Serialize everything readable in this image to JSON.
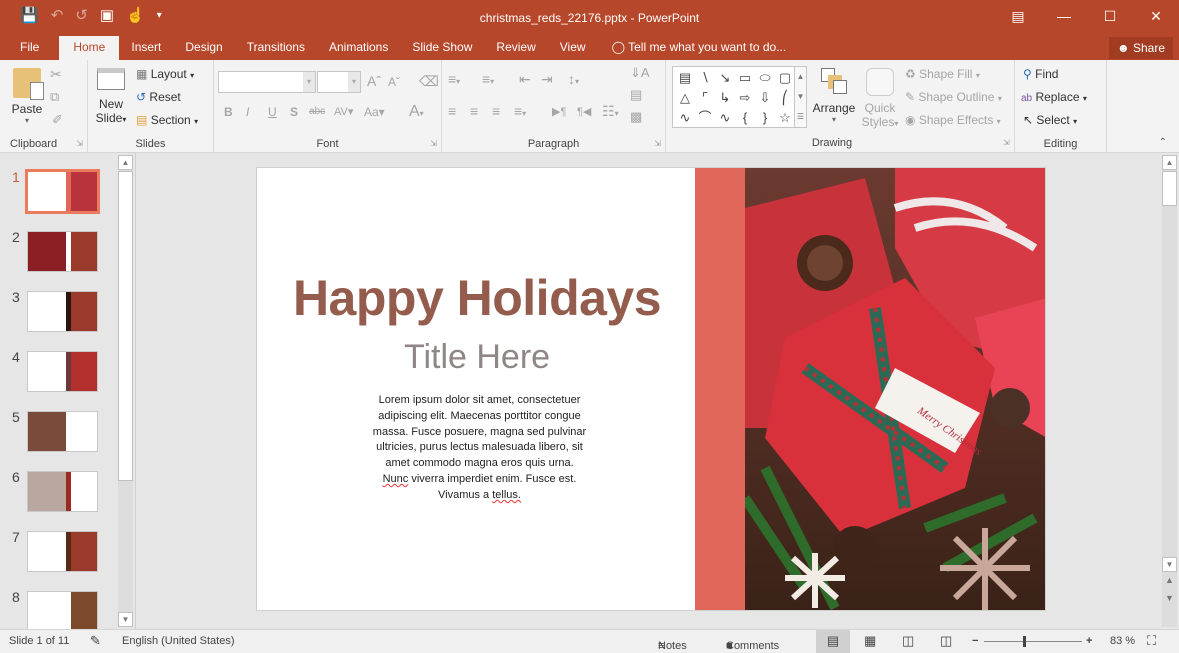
{
  "window": {
    "title": "christmas_reds_22176.pptx - PowerPoint",
    "controls": [
      "ribbon-display",
      "minimize",
      "maximize",
      "close"
    ]
  },
  "qat": {
    "icons": [
      "save-icon",
      "undo-icon",
      "redo-icon",
      "start-from-beginning-icon",
      "touch-mode-icon",
      "customize-qat-icon"
    ]
  },
  "tabs": [
    {
      "label": "File"
    },
    {
      "label": "Home",
      "active": true
    },
    {
      "label": "Insert"
    },
    {
      "label": "Design"
    },
    {
      "label": "Transitions"
    },
    {
      "label": "Animations"
    },
    {
      "label": "Slide Show"
    },
    {
      "label": "Review"
    },
    {
      "label": "View"
    }
  ],
  "tellme": "Tell me what you want to do...",
  "share": "Share",
  "ribbon": {
    "clipboard": {
      "label": "Clipboard",
      "paste": "Paste"
    },
    "slides": {
      "label": "Slides",
      "new_slide_1": "New",
      "new_slide_2": "Slide",
      "layout": "Layout",
      "reset": "Reset",
      "section": "Section"
    },
    "font": {
      "label": "Font",
      "font_name": "",
      "font_size": ""
    },
    "paragraph": {
      "label": "Paragraph"
    },
    "drawing": {
      "label": "Drawing",
      "arrange": "Arrange",
      "quick_styles_1": "Quick",
      "quick_styles_2": "Styles",
      "shape_fill": "Shape Fill",
      "shape_outline": "Shape Outline",
      "shape_effects": "Shape Effects"
    },
    "editing": {
      "label": "Editing",
      "find": "Find",
      "replace": "Replace",
      "select": "Select"
    }
  },
  "thumbnails": [
    {
      "num": "1",
      "selected": true
    },
    {
      "num": "2"
    },
    {
      "num": "3"
    },
    {
      "num": "4"
    },
    {
      "num": "5"
    },
    {
      "num": "6"
    },
    {
      "num": "7"
    },
    {
      "num": "8"
    }
  ],
  "slide": {
    "title": "Happy Holidays",
    "subtitle": "Title Here",
    "body_lines": [
      "Lorem ipsum dolor sit amet, consectetuer",
      "adipiscing elit. Maecenas porttitor congue",
      "massa. Fusce posuere, magna sed pulvinar",
      "ultricies, purus lectus malesuada libero, sit",
      "amet commodo magna eros quis urna."
    ],
    "body_line6_a": "Nunc",
    "body_line6_b": " viverra imperdiet enim. Fusce est.",
    "body_line7_a": "Vivamus a ",
    "body_line7_b": "tellus.",
    "photo_tag": "Merry Christmas",
    "accent_color": "#e0675a",
    "title_color": "#935c4c"
  },
  "status": {
    "slide_info": "Slide 1 of 11",
    "language": "English (United States)",
    "notes": "Notes",
    "comments": "Comments",
    "zoom": "83 %",
    "zoom_level_percent": 83
  }
}
